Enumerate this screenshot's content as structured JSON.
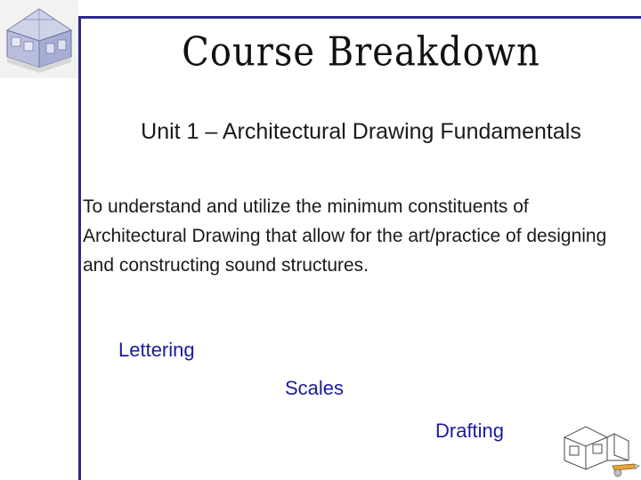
{
  "slide": {
    "course_title": "Course Breakdown",
    "unit_line": "Unit 1 – Architectural Drawing Fundamentals",
    "body_text": "To understand and utilize the minimum constituents of Architectural Drawing that allow for the art/practice of designing and constructing sound structures.",
    "keywords": [
      {
        "label": "Lettering"
      },
      {
        "label": "Scales"
      },
      {
        "label": "Drafting"
      }
    ],
    "accent_color": "#2a2a8c",
    "keyword_color": "#1b1b9c",
    "images": {
      "top_left": "house-model-thumbnail",
      "bottom_right": "drafting-sketch-clipart"
    }
  }
}
